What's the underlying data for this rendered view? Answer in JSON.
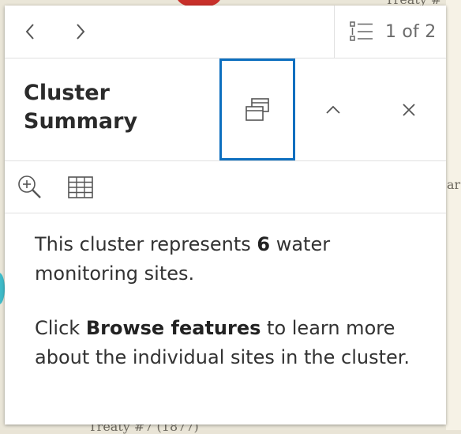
{
  "map": {
    "label_top": "Treaty #",
    "label_right": "ar",
    "label_bottom": "Treaty #7 (1877)"
  },
  "nav": {
    "prev_icon": "chevron-left-icon",
    "next_icon": "chevron-right-icon"
  },
  "pager": {
    "icon": "list-icon",
    "text": "1 of 2"
  },
  "header": {
    "title_line1": "Cluster",
    "title_line2": "Summary",
    "dock_icon": "dock-icon",
    "collapse_icon": "chevron-up-icon",
    "close_icon": "close-icon"
  },
  "actions": {
    "zoom_icon": "zoom-in-icon",
    "table_icon": "table-icon"
  },
  "content": {
    "p1_before": "This cluster represents ",
    "p1_bold": "6",
    "p1_after": " water monitoring sites.",
    "p2_before": "Click ",
    "p2_bold": "Browse features",
    "p2_after": " to learn more about the individual sites in the cluster."
  },
  "colors": {
    "accent": "#0d6fbf",
    "text": "#323232",
    "muted": "#6b6b6b",
    "map_bg": "#eae6d8"
  }
}
